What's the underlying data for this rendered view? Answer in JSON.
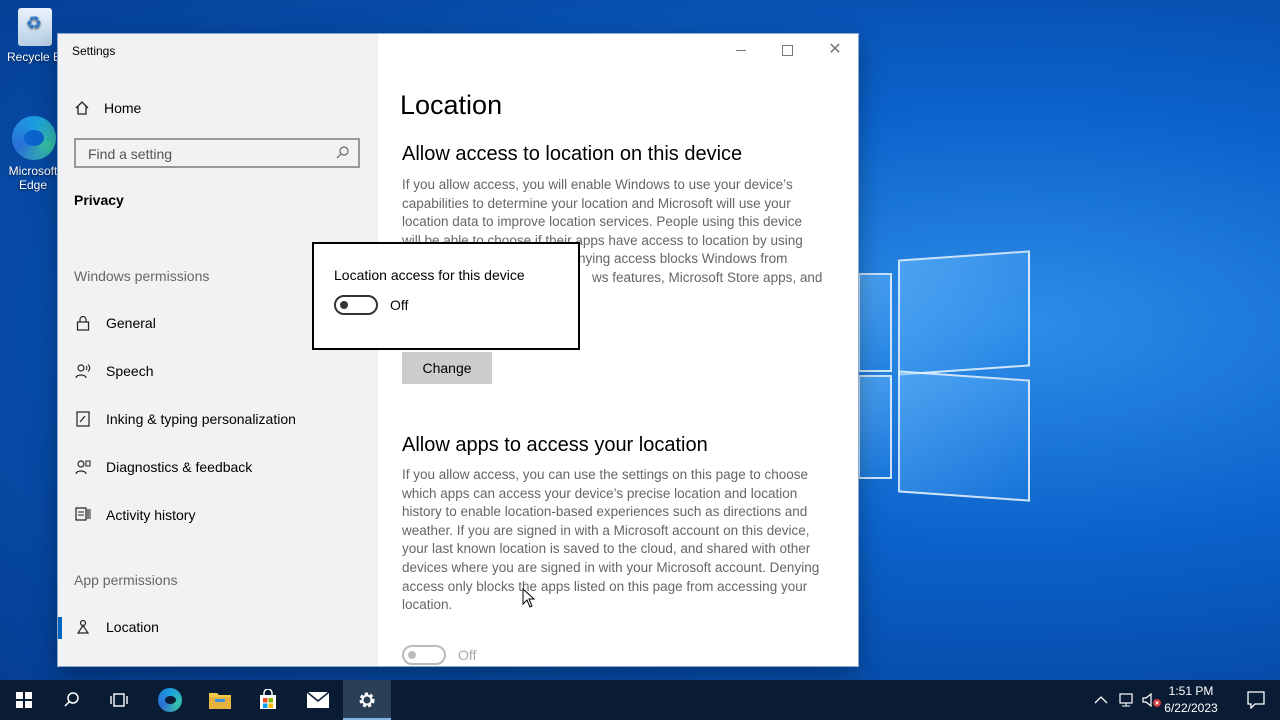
{
  "desktop": {
    "icons": [
      {
        "label": "Recycle Bin",
        "icon": "recycle-bin-icon"
      },
      {
        "label": "Microsoft Edge",
        "icon": "edge-icon"
      }
    ]
  },
  "window": {
    "title": "Settings",
    "controls": {
      "minimize": "minimize-icon",
      "maximize": "maximize-icon",
      "close": "close-icon"
    }
  },
  "sidebar": {
    "home": "Home",
    "search_placeholder": "Find a setting",
    "section": "Privacy",
    "groups": [
      {
        "label": "Windows permissions",
        "items": [
          {
            "label": "General",
            "icon": "lock-icon"
          },
          {
            "label": "Speech",
            "icon": "speech-icon"
          },
          {
            "label": "Inking & typing personalization",
            "icon": "inking-icon"
          },
          {
            "label": "Diagnostics & feedback",
            "icon": "diagnostics-icon"
          },
          {
            "label": "Activity history",
            "icon": "activity-history-icon"
          }
        ]
      },
      {
        "label": "App permissions",
        "items": [
          {
            "label": "Location",
            "icon": "location-icon",
            "active": true
          }
        ]
      }
    ]
  },
  "content": {
    "title": "Location",
    "section1": {
      "heading": "Allow access to location on this device",
      "line1": "If you allow access, you will enable Windows to use your device’s",
      "line2": "capabilities to determine your location and Microsoft will use your",
      "line3": "location data to improve location services. People using this device",
      "line4": "will be able to choose if their apps have access to location by using",
      "line5": "nying access blocks Windows from",
      "line6": "ws features, Microsoft Store apps, and",
      "change_button": "Change"
    },
    "section2": {
      "heading": "Allow apps to access your location",
      "lines": [
        "If you allow access, you can use the settings on this page to choose",
        "which apps can access your device’s precise location and location",
        "history to enable location-based experiences such as directions and",
        "weather. If you are signed in with a Microsoft account on this device,",
        "your last known location is saved to the cloud, and shared with other",
        "devices where you are signed in with your Microsoft account. Denying",
        "access only blocks the apps listed on this page from accessing your",
        "location."
      ],
      "toggle_state": "Off"
    }
  },
  "flyout": {
    "title": "Location access for this device",
    "toggle_state": "Off"
  },
  "taskbar": {
    "items": [
      "start-icon",
      "search-icon",
      "task-view-icon",
      "edge-icon",
      "file-explorer-icon",
      "store-icon",
      "mail-icon",
      "settings-icon"
    ],
    "tray": [
      "chevron-up-icon",
      "network-icon",
      "volume-muted-icon",
      "action-center-icon"
    ],
    "time": "1:51 PM",
    "date": "6/22/2023"
  },
  "colors": {
    "accent": "#0067c0",
    "taskbar": "#0a1c33",
    "sidebar": "#f2f2f2"
  }
}
